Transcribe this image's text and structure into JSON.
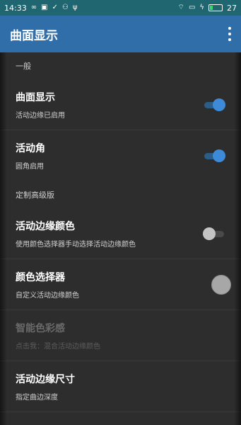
{
  "status_bar": {
    "time": "14:33",
    "battery_level": 27,
    "battery_label": "27",
    "icons_left": [
      "infinity-icon",
      "image-icon",
      "check-circle-icon",
      "share-icon",
      "usb-icon"
    ],
    "icons_right": [
      "wifi-icon",
      "tablet-icon",
      "charging-icon",
      "battery-icon"
    ]
  },
  "app_bar": {
    "title": "曲面显示"
  },
  "sections": {
    "general": {
      "header": "一般"
    },
    "advanced": {
      "header": "定制高级版"
    }
  },
  "prefs": {
    "curved_display": {
      "title": "曲面显示",
      "summary": "活动边缘已启用",
      "enabled": true
    },
    "active_corner": {
      "title": "活动角",
      "summary": "圆角启用",
      "enabled": true
    },
    "edge_color": {
      "title": "活动边缘颜色",
      "summary": "使用颜色选择器手动选择活动边缘颜色",
      "enabled": false
    },
    "color_picker": {
      "title": "颜色选择器",
      "summary": "自定义活动边缘颜色",
      "swatch_color": "#a7a7a7"
    },
    "smart_color": {
      "title": "智能色彩感",
      "summary": "点击我：混合活动边缘颜色",
      "disabled": true
    },
    "edge_size": {
      "title": "活动边缘尺寸",
      "summary": "指定曲边深度"
    }
  },
  "colors": {
    "status_bar": "#1f6670",
    "app_bar": "#2f6ea8",
    "background": "#2d2d2d",
    "accent": "#3d8bd8"
  }
}
